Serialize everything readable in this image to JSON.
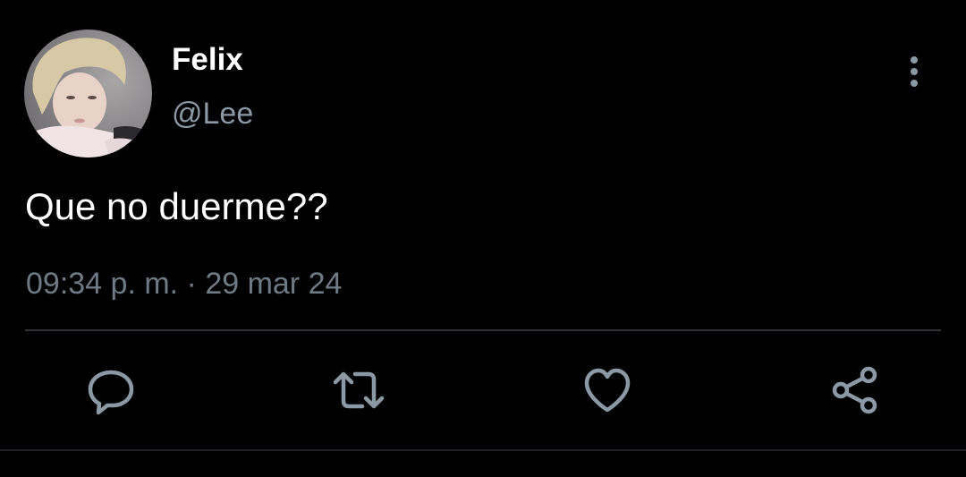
{
  "tweet": {
    "display_name": "Felix",
    "handle": "@Lee",
    "text": "Que no duerme??",
    "timestamp": "09:34 p. m. · 29 mar 24"
  },
  "icons": {
    "more": "more-vertical-icon",
    "reply": "reply-icon",
    "retweet": "retweet-icon",
    "like": "heart-icon",
    "share": "share-icon"
  },
  "colors": {
    "background": "#000000",
    "primary_text": "#ffffff",
    "secondary_text": "#8b98a5",
    "timestamp_text": "#6e7a85",
    "icon": "#8b98a5",
    "divider": "#2f3336"
  }
}
